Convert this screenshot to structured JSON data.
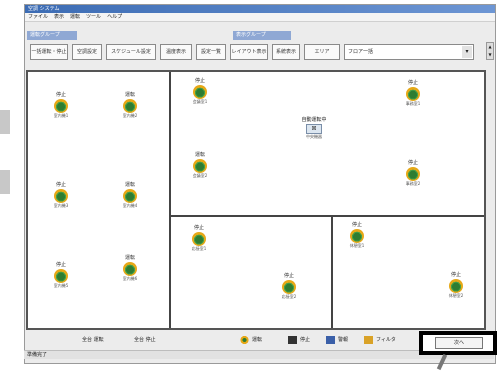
{
  "window": {
    "title": "空調 システム"
  },
  "menu": [
    "ファイル",
    "表示",
    "運転",
    "ツール",
    "ヘルプ"
  ],
  "groups": {
    "left": "運転グループ",
    "right": "表示グループ"
  },
  "toolbar": {
    "buttons": [
      "一括運転・停止",
      "空調設定",
      "スケジュール設定",
      "温度表示",
      "設定一覧",
      "レイアウト表示",
      "系統表示",
      "エリア",
      "フロア"
    ],
    "floor_select": "フロア一括"
  },
  "center_unit": {
    "status": "自動運転中",
    "name": "中央機器"
  },
  "units": [
    {
      "status": "停止",
      "name": "室内機1"
    },
    {
      "status": "運転",
      "name": "室内機2"
    },
    {
      "status": "停止",
      "name": "室内機3"
    },
    {
      "status": "運転",
      "name": "室内機4"
    },
    {
      "status": "停止",
      "name": "室内機5"
    },
    {
      "status": "運転",
      "name": "室内機6"
    },
    {
      "status": "停止",
      "name": "会議室1"
    },
    {
      "status": "運転",
      "name": "会議室2"
    },
    {
      "status": "停止",
      "name": "事務室1"
    },
    {
      "status": "停止",
      "name": "事務室2"
    },
    {
      "status": "停止",
      "name": "応接室1"
    },
    {
      "status": "停止",
      "name": "応接室2"
    },
    {
      "status": "停止",
      "name": "休憩室1"
    },
    {
      "status": "停止",
      "name": "休憩室2"
    }
  ],
  "bottom": {
    "count_on": "全台 運転",
    "count_off": "全台 停止",
    "legend": [
      "運転",
      "停止",
      "警報",
      "フィルタ"
    ],
    "next_button": "次へ"
  },
  "status": "準備完了",
  "colors": {
    "title_bar": "#3c6cb4",
    "group_header": "#8fa8d4",
    "unit_ring": "#e6a817",
    "unit_core": "#2e7d32"
  }
}
